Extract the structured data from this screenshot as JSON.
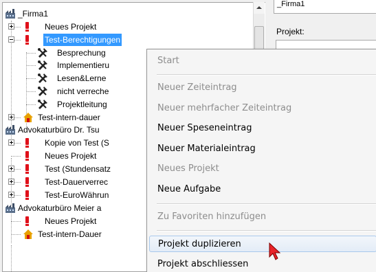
{
  "tree": {
    "items": [
      {
        "label": "_Firma1",
        "type": "company"
      },
      {
        "label": "Neues Projekt",
        "type": "project"
      },
      {
        "label": "Test-Berechtigungen",
        "type": "project",
        "selected": true
      },
      {
        "label": "Besprechung",
        "type": "task"
      },
      {
        "label": "Implementieru",
        "type": "task"
      },
      {
        "label": "Lesen&Lerne",
        "type": "task"
      },
      {
        "label": "nicht verreche",
        "type": "task"
      },
      {
        "label": "Projektleitung",
        "type": "task"
      },
      {
        "label": "Test-intern-dauer",
        "type": "internal"
      },
      {
        "label": "Advokaturbüro Dr. Tsu",
        "type": "company"
      },
      {
        "label": "Kopie von Test (S",
        "type": "project"
      },
      {
        "label": "Neues Projekt",
        "type": "project"
      },
      {
        "label": "Test (Stundensatz",
        "type": "project"
      },
      {
        "label": "Test-Dauerverrec",
        "type": "project"
      },
      {
        "label": "Test-EuroWährun",
        "type": "project"
      },
      {
        "label": "Advokaturbüro Meier a",
        "type": "company"
      },
      {
        "label": "Neues Projekt",
        "type": "project"
      },
      {
        "label": "Test-intern-Dauer",
        "type": "internal"
      }
    ]
  },
  "right_panel": {
    "field_value": "_Firma1",
    "projekt_label": "Projekt:"
  },
  "context_menu": {
    "items": [
      {
        "label": "Start",
        "enabled": false
      },
      {
        "label": "Neuer Zeiteintrag",
        "enabled": false
      },
      {
        "label": "Neuer mehrfacher Zeiteintrag",
        "enabled": false
      },
      {
        "label": "Neuer Speseneintrag",
        "enabled": true
      },
      {
        "label": "Neuer Materialeintrag",
        "enabled": true
      },
      {
        "label": "Neues Projekt",
        "enabled": false
      },
      {
        "label": "Neue Aufgabe",
        "enabled": true
      },
      {
        "label": "Zu Favoriten hinzufügen",
        "enabled": false
      },
      {
        "label": "Projekt duplizieren",
        "enabled": true,
        "hovered": true
      },
      {
        "label": "Projekt abschliessen",
        "enabled": true
      }
    ]
  },
  "colors": {
    "selection": "#3399ff",
    "project_icon": "#e0101a",
    "disabled_text": "#8d8d8d"
  }
}
